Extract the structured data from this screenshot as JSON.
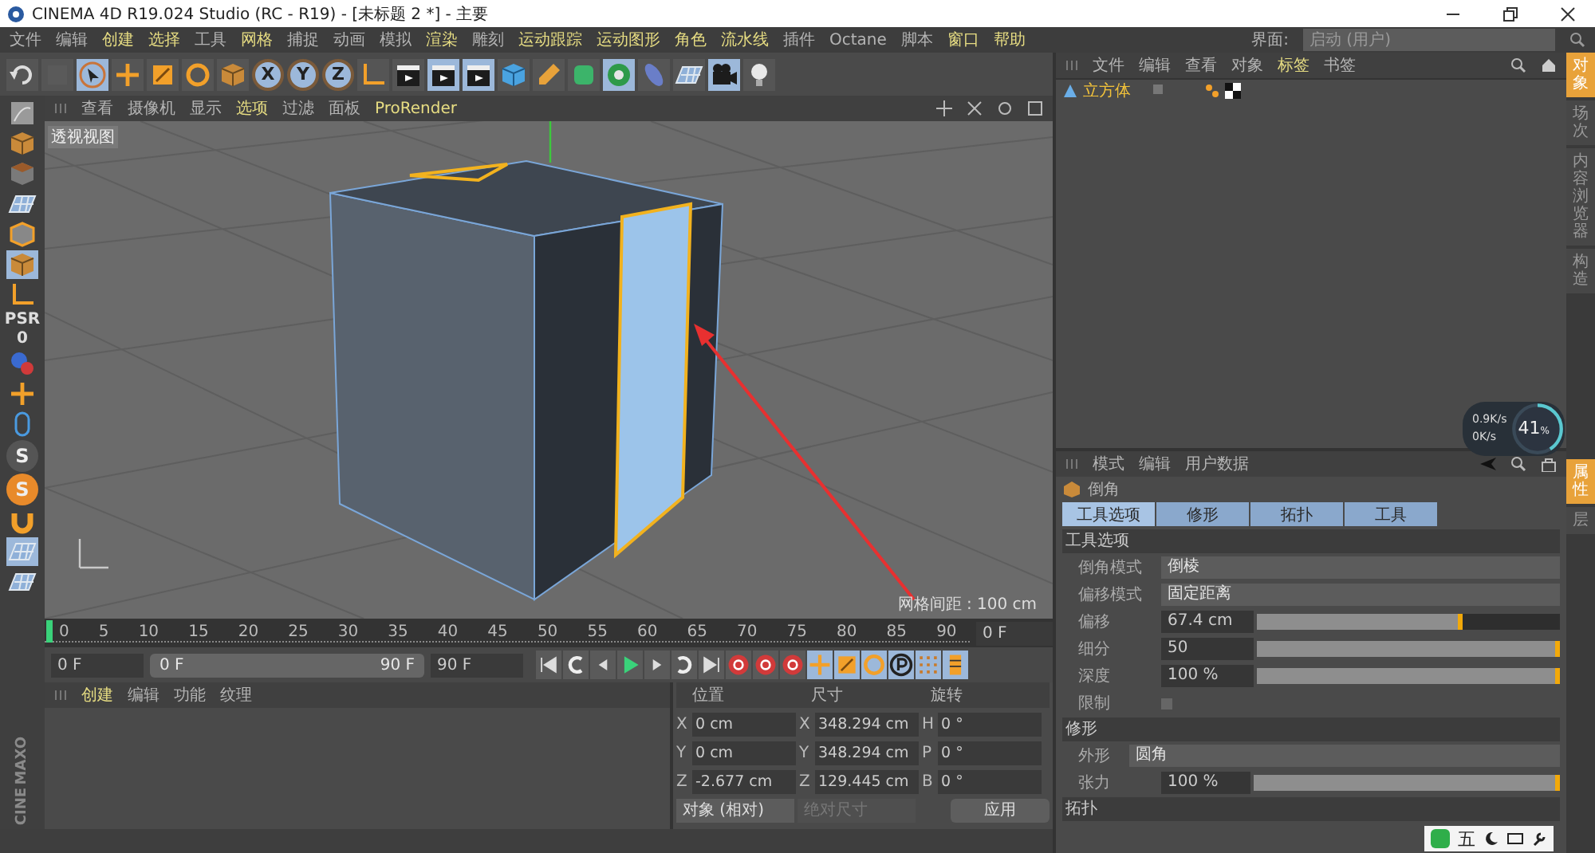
{
  "window": {
    "title": "CINEMA 4D R19.024 Studio (RC - R19) - [未标题 2 *] - 主要"
  },
  "menu": [
    {
      "label": "文件",
      "highlighted": false
    },
    {
      "label": "编辑",
      "highlighted": false
    },
    {
      "label": "创建",
      "highlighted": true
    },
    {
      "label": "选择",
      "highlighted": true
    },
    {
      "label": "工具",
      "highlighted": false
    },
    {
      "label": "网格",
      "highlighted": true
    },
    {
      "label": "捕捉",
      "highlighted": false
    },
    {
      "label": "动画",
      "highlighted": false
    },
    {
      "label": "模拟",
      "highlighted": false
    },
    {
      "label": "渲染",
      "highlighted": true
    },
    {
      "label": "雕刻",
      "highlighted": false
    },
    {
      "label": "运动跟踪",
      "highlighted": true
    },
    {
      "label": "运动图形",
      "highlighted": true
    },
    {
      "label": "角色",
      "highlighted": true
    },
    {
      "label": "流水线",
      "highlighted": true
    },
    {
      "label": "插件",
      "highlighted": false
    },
    {
      "label": "Octane",
      "highlighted": false
    },
    {
      "label": "脚本",
      "highlighted": false
    },
    {
      "label": "窗口",
      "highlighted": true
    },
    {
      "label": "帮助",
      "highlighted": true
    }
  ],
  "layout": {
    "label": "界面:",
    "value": "启动 (用户)"
  },
  "toolbar": [
    {
      "kind": "undo",
      "active": false
    },
    {
      "kind": "redo",
      "active": false
    },
    {
      "kind": "select",
      "active": true
    },
    {
      "kind": "move",
      "active": false
    },
    {
      "kind": "scale",
      "active": false
    },
    {
      "kind": "rotate",
      "active": false
    },
    {
      "kind": "recent",
      "active": false
    },
    {
      "kind": "axis",
      "label": "X",
      "active": true
    },
    {
      "kind": "axis",
      "label": "Y",
      "active": true
    },
    {
      "kind": "axis",
      "label": "Z",
      "active": true
    },
    {
      "kind": "coord",
      "active": false
    },
    {
      "kind": "render",
      "active": false
    },
    {
      "kind": "render",
      "active": true
    },
    {
      "kind": "render",
      "active": true
    },
    {
      "kind": "cube",
      "active": false
    },
    {
      "kind": "pen",
      "active": false
    },
    {
      "kind": "subdiv",
      "active": false
    },
    {
      "kind": "cloner",
      "active": true
    },
    {
      "kind": "deformer",
      "active": false
    },
    {
      "kind": "floor",
      "active": false
    },
    {
      "kind": "camera",
      "active": true
    },
    {
      "kind": "light",
      "active": false
    }
  ],
  "left_toolbar": [
    {
      "kind": "model",
      "active": false
    },
    {
      "kind": "object",
      "active": false
    },
    {
      "kind": "texture",
      "active": false
    },
    {
      "kind": "points",
      "active": false
    },
    {
      "kind": "edges",
      "active": false
    },
    {
      "kind": "polygons",
      "active": true
    },
    {
      "kind": "axis-tool",
      "active": false
    },
    {
      "kind": "text",
      "label": "PSR",
      "active": false
    },
    {
      "kind": "text",
      "label": "0",
      "active": false
    },
    {
      "kind": "sphere",
      "active": false
    },
    {
      "kind": "snap",
      "active": false
    },
    {
      "kind": "mouse",
      "active": false
    },
    {
      "kind": "logo",
      "label": "S",
      "active": false
    },
    {
      "kind": "logo",
      "label": "S",
      "active": true
    },
    {
      "kind": "magnet",
      "active": false
    },
    {
      "kind": "workplane",
      "active": true
    },
    {
      "kind": "workplane",
      "active": false
    }
  ],
  "brand": [
    "MAXO",
    "CINE"
  ],
  "viewport": {
    "menu": [
      {
        "label": "查看",
        "highlighted": false
      },
      {
        "label": "摄像机",
        "highlighted": false
      },
      {
        "label": "显示",
        "highlighted": false
      },
      {
        "label": "选项",
        "highlighted": true
      },
      {
        "label": "过滤",
        "highlighted": false
      },
      {
        "label": "面板",
        "highlighted": false
      },
      {
        "label": "ProRender",
        "highlighted": true
      }
    ],
    "view_name": "透视视图",
    "grid_spacing": "网格间距 : 100 cm"
  },
  "timeline": {
    "ticks": [
      "0",
      "5",
      "10",
      "15",
      "20",
      "25",
      "30",
      "35",
      "40",
      "45",
      "50",
      "55",
      "60",
      "65",
      "70",
      "75",
      "80",
      "85",
      "90"
    ],
    "current_frame": "0 F",
    "start": "0 F",
    "range": {
      "start": "0 F",
      "end": "90 F"
    },
    "end": "90 F"
  },
  "transport": [
    {
      "kind": "to-start",
      "active": false
    },
    {
      "kind": "loop-back",
      "active": false
    },
    {
      "kind": "step-back",
      "active": false
    },
    {
      "kind": "play",
      "active": false
    },
    {
      "kind": "step-forward",
      "active": false
    },
    {
      "kind": "loop-forward",
      "active": false
    },
    {
      "kind": "to-end",
      "active": false
    },
    {
      "kind": "record",
      "active": false
    },
    {
      "kind": "autokey",
      "active": false
    },
    {
      "kind": "help-key",
      "active": false
    },
    {
      "kind": "move",
      "active": true
    },
    {
      "kind": "scale",
      "active": true
    },
    {
      "kind": "rotate",
      "active": true
    },
    {
      "kind": "param",
      "active": true
    },
    {
      "kind": "dots",
      "active": true
    },
    {
      "kind": "film",
      "active": true
    }
  ],
  "materials": {
    "menu": [
      {
        "label": "创建",
        "highlighted": true
      },
      {
        "label": "编辑",
        "highlighted": false
      },
      {
        "label": "功能",
        "highlighted": false
      },
      {
        "label": "纹理",
        "highlighted": false
      }
    ]
  },
  "coordinates": {
    "headers": [
      "位置",
      "尺寸",
      "旋转"
    ],
    "rows": [
      {
        "axes": [
          "X",
          "X",
          "H"
        ],
        "values": [
          "0 cm",
          "348.294 cm",
          "0 °"
        ]
      },
      {
        "axes": [
          "Y",
          "Y",
          "P"
        ],
        "values": [
          "0 cm",
          "348.294 cm",
          "0 °"
        ]
      },
      {
        "axes": [
          "Z",
          "Z",
          "B"
        ],
        "values": [
          "-2.677 cm",
          "129.445 cm",
          "0 °"
        ]
      }
    ],
    "mode": "对象 (相对)",
    "size_mode": {
      "label": "绝对尺寸",
      "disabled": true
    },
    "apply": "应用"
  },
  "objects": {
    "menu": [
      {
        "label": "文件",
        "highlighted": false
      },
      {
        "label": "编辑",
        "highlighted": false
      },
      {
        "label": "查看",
        "highlighted": false
      },
      {
        "label": "对象",
        "highlighted": false
      },
      {
        "label": "标签",
        "highlighted": true
      },
      {
        "label": "书签",
        "highlighted": false
      }
    ],
    "items": [
      {
        "name": "立方体",
        "selected": true
      }
    ]
  },
  "side_tabs_top": [
    {
      "label": "对象",
      "selected": true
    },
    {
      "label": "场次",
      "selected": false
    },
    {
      "label": "内容浏览器",
      "selected": false
    },
    {
      "label": "构造",
      "selected": false
    }
  ],
  "side_tabs_bottom": [
    {
      "label": "属性",
      "selected": true
    },
    {
      "label": "层",
      "selected": false
    }
  ],
  "attributes": {
    "menu": [
      {
        "label": "模式",
        "highlighted": false
      },
      {
        "label": "编辑",
        "highlighted": false
      },
      {
        "label": "用户数据",
        "highlighted": false
      }
    ],
    "tool": "倒角",
    "tabs": [
      {
        "label": "工具选项",
        "selected": true
      },
      {
        "label": "修形",
        "selected": false
      },
      {
        "label": "拓扑",
        "selected": false
      },
      {
        "label": "工具",
        "selected": false
      }
    ],
    "sections": [
      {
        "title": "工具选项",
        "fields": [
          {
            "kind": "dropdown",
            "label": "倒角模式",
            "value": "倒棱"
          },
          {
            "kind": "dropdown",
            "label": "偏移模式",
            "value": "固定距离"
          },
          {
            "kind": "slider",
            "label": "偏移",
            "value": "67.4 cm",
            "level": 0.68
          },
          {
            "kind": "slider",
            "label": "细分",
            "value": "50",
            "level": 1
          },
          {
            "kind": "slider",
            "label": "深度",
            "value": "100 %",
            "level": 1
          },
          {
            "kind": "checkbox",
            "label": "限制",
            "checked": false
          }
        ]
      },
      {
        "title": "修形",
        "fields": [
          {
            "kind": "dropdown",
            "label": "外形",
            "value": "圆角"
          },
          {
            "kind": "slider",
            "label": "张力",
            "value": "100 %",
            "level": 1
          }
        ]
      },
      {
        "title": "拓扑"
      }
    ]
  },
  "net_monitor": {
    "upload": "0.9K/s",
    "download": "0K/s",
    "load": "41",
    "unit": "%",
    "level": 0.41
  },
  "ime_bar": {
    "label": "五"
  }
}
